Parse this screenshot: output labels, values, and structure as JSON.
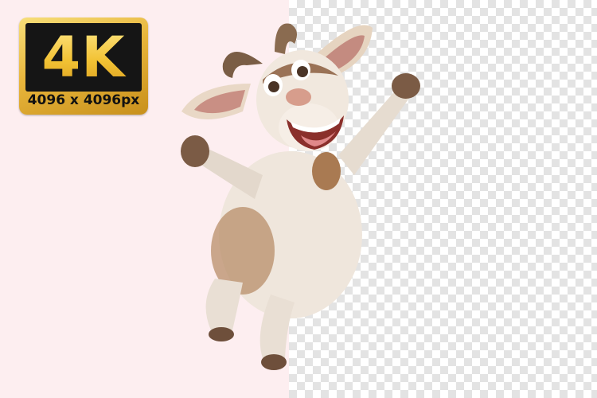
{
  "badge": {
    "main": "4K",
    "sub": "4096 x 4096px"
  },
  "colors": {
    "left_background": "#fdeef0",
    "checker_light": "#ffffff",
    "checker_dark": "#e3e3e3",
    "badge_gold": "#e8b53b",
    "badge_dark": "#151515"
  },
  "image": {
    "subject": "goat-illustration"
  }
}
